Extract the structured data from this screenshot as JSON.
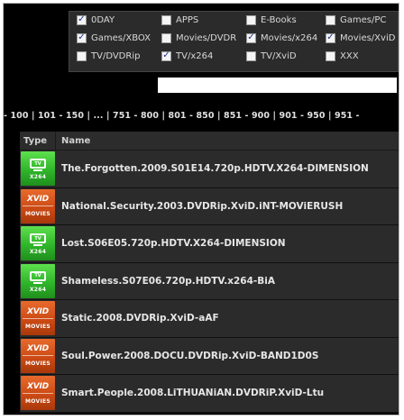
{
  "filters": [
    {
      "label": "0DAY",
      "checked": true
    },
    {
      "label": "APPS",
      "checked": false
    },
    {
      "label": "E-Books",
      "checked": false
    },
    {
      "label": "Games/PC",
      "checked": false
    },
    {
      "label": "Games/XBOX",
      "checked": true
    },
    {
      "label": "Movies/DVDR",
      "checked": false
    },
    {
      "label": "Movies/x264",
      "checked": true
    },
    {
      "label": "Movies/XviD",
      "checked": true
    },
    {
      "label": "TV/DVDRip",
      "checked": false
    },
    {
      "label": "TV/x264",
      "checked": true
    },
    {
      "label": "TV/XviD",
      "checked": false
    },
    {
      "label": "XXX",
      "checked": false
    }
  ],
  "search": {
    "value": ""
  },
  "pagination": "- 100 | 101 - 150 | ... | 751 - 800 | 801 - 850 | 851 - 900 | 901 - 950 | 951 -",
  "table": {
    "headers": {
      "type": "Type",
      "name": "Name"
    },
    "rows": [
      {
        "type": "tv",
        "name": "The.Forgotten.2009.S01E14.720p.HDTV.X264-DIMENSION"
      },
      {
        "type": "xvid",
        "name": "National.Security.2003.DVDRip.XviD.iNT-MOViERUSH"
      },
      {
        "type": "tv",
        "name": "Lost.S06E05.720p.HDTV.X264-DIMENSION"
      },
      {
        "type": "tv",
        "name": "Shameless.S07E06.720p.HDTV.x264-BiA"
      },
      {
        "type": "xvid",
        "name": "Static.2008.DVDRip.XviD-aAF"
      },
      {
        "type": "xvid",
        "name": "Soul.Power.2008.DOCU.DVDRip.XviD-BAND1D0S"
      },
      {
        "type": "xvid",
        "name": "Smart.People.2008.LiTHUANiAN.DVDRiP.XviD-Ltu"
      }
    ]
  },
  "badges": {
    "tv": {
      "screen": "TV",
      "sub": "X264",
      "icon": "tv-x264-icon"
    },
    "xvid": {
      "logo": "XVID",
      "sub": "MOVIES",
      "icon": "xvid-movies-icon"
    }
  }
}
